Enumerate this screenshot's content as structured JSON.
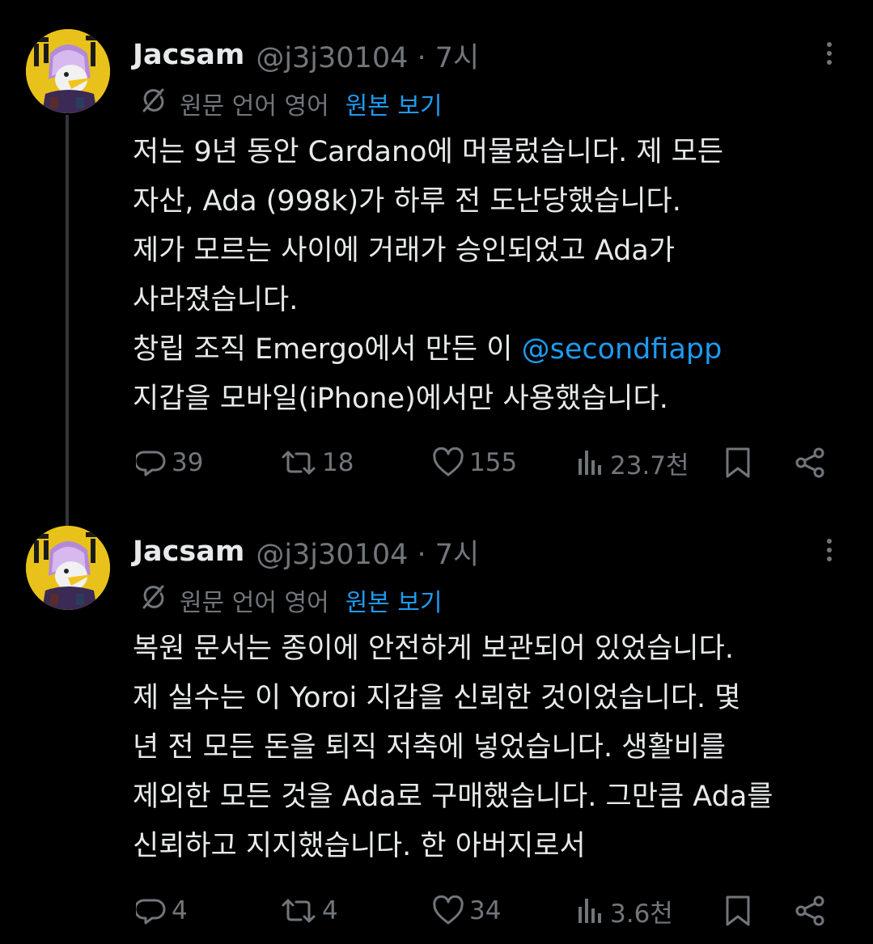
{
  "tweets": [
    {
      "name": "Jacsam",
      "handle": "@j3j30104 · 7시",
      "translate_label": "원문 언어 영어",
      "view_original": "원본 보기",
      "lines": [
        "저는 9년 동안 Cardano에 머물렀습니다. 제 모든",
        "자산, Ada (998k)가 하루 전 도난당했습니다.",
        "제가 모르는 사이에 거래가 승인되었고 Ada가",
        "사라졌습니다.",
        "창립 조직 Emergo에서 만든 이 ",
        "지갑을 모바일(iPhone)에서만 사용했습니다."
      ],
      "mention": "@secondfiapp",
      "replies": "39",
      "reposts": "18",
      "likes": "155",
      "views": "23.7천"
    },
    {
      "name": "Jacsam",
      "handle": "@j3j30104 · 7시",
      "translate_label": "원문 언어 영어",
      "view_original": "원본 보기",
      "lines": [
        "복원 문서는 종이에 안전하게 보관되어 있었습니다.",
        "제 실수는 이 Yoroi 지갑을 신뢰한 것이었습니다. 몇",
        "년 전 모든 돈을 퇴직 저축에 넣었습니다. 생활비를",
        "제외한 모든 것을 Ada로 구매했습니다. 그만큼 Ada를",
        "신뢰하고 지지했습니다. 한 아버지로서"
      ],
      "replies": "4",
      "reposts": "4",
      "likes": "34",
      "views": "3.6천"
    }
  ],
  "icons": {
    "reply": "speech-bubble",
    "repost": "repost-arrows",
    "like": "heart",
    "views": "bar-chart",
    "bookmark": "bookmark",
    "share": "share-nodes",
    "translate": "no-translate-slash",
    "more": "vertical-ellipsis"
  },
  "colors": {
    "background": "#000000",
    "text": "#e7e9ea",
    "muted": "#71767b",
    "accent": "#1d9bf0",
    "avatar_bg": "#e8c21a"
  }
}
